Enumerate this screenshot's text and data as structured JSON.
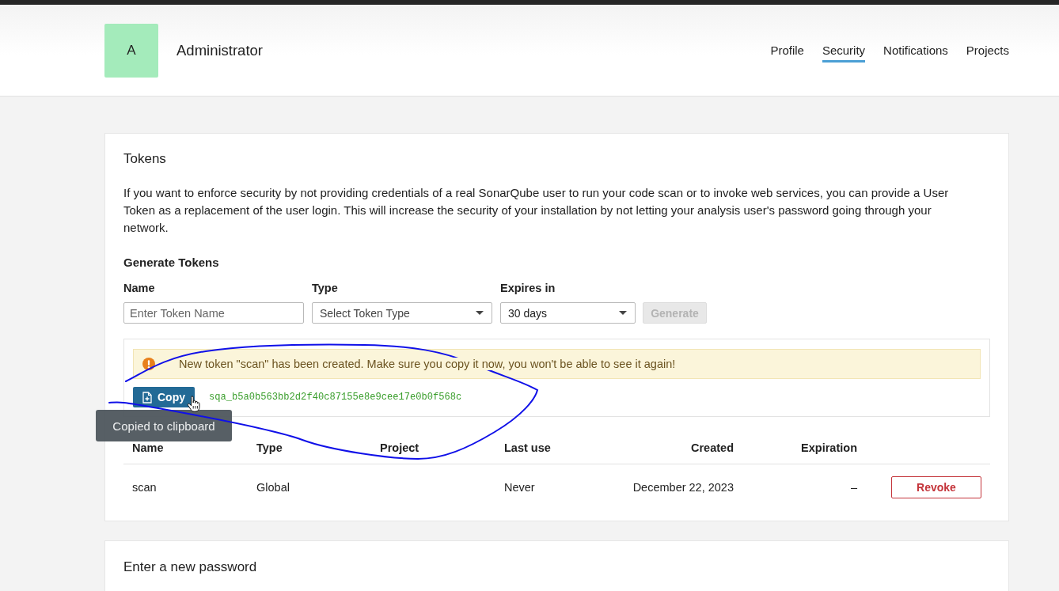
{
  "header": {
    "avatar": "A",
    "user_name": "Administrator",
    "nav": [
      {
        "label": "Profile",
        "selected": false
      },
      {
        "label": "Security",
        "selected": true
      },
      {
        "label": "Notifications",
        "selected": false
      },
      {
        "label": "Projects",
        "selected": false
      }
    ]
  },
  "tokens": {
    "title": "Tokens",
    "description": "If you want to enforce security by not providing credentials of a real SonarQube user to run your code scan or to invoke web services, you can provide a User Token as a replacement of the user login. This will increase the security of your installation by not letting your analysis user's password going through your network.",
    "generate": {
      "heading": "Generate Tokens",
      "name": {
        "label": "Name",
        "placeholder": "Enter Token Name"
      },
      "type": {
        "label": "Type",
        "placeholder": "Select Token Type"
      },
      "expires": {
        "label": "Expires in",
        "value": "30 days"
      },
      "button": {
        "label": "Generate",
        "disabled": true
      }
    },
    "new_token": {
      "message": "New token \"scan\" has been created. Make sure you copy it now, you won't be able to see it again!",
      "copy_button": "Copy",
      "value": "sqa_b5a0b563bb2d2f40c87155e8e9cee17e0b0f568c",
      "tooltip": "Copied to clipboard"
    },
    "table": {
      "columns": [
        "Name",
        "Type",
        "Project",
        "Last use",
        "Created",
        "Expiration"
      ],
      "rows": [
        {
          "name": "scan",
          "type": "Global",
          "last_use": "Never",
          "created": "December 22, 2023",
          "expiration": "–",
          "action": "Revoke"
        }
      ]
    }
  },
  "password": {
    "title": "Enter a new password"
  }
}
